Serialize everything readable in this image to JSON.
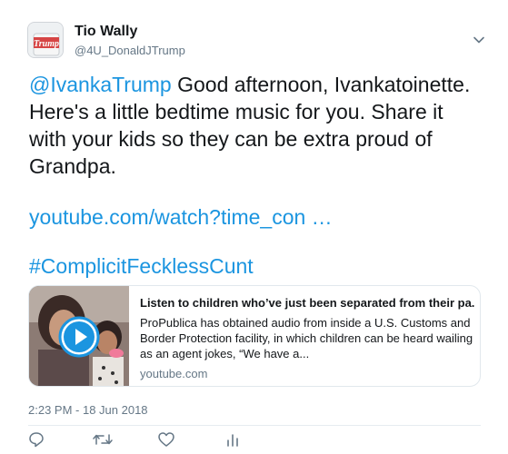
{
  "user": {
    "display_name": "Tio Wally",
    "handle": "@4U_DonaldJTrump",
    "avatar_text": "Trump"
  },
  "tweet": {
    "mention": "@IvankaTrump",
    "text": " Good afternoon, Ivankatoinette. Here's a little bedtime music for you. Share it with your kids so they can be extra proud of Grandpa.",
    "link": "youtube.com/watch?time_con …",
    "hashtag": "#ComplicitFecklessCunt",
    "timestamp": "2:23 PM - 18 Jun 2018"
  },
  "card": {
    "title": "Listen to children who’ve just been separated from their pa...",
    "description": "ProPublica has obtained audio from inside a U.S. Customs and Border Protection facility, in which children can be heard wailing as an agent jokes, “We have a...",
    "domain": "youtube.com"
  },
  "icons": {
    "menu": "chevron-down-icon",
    "reply": "reply-icon",
    "retweet": "retweet-icon",
    "like": "heart-icon",
    "analytics": "analytics-icon"
  },
  "colors": {
    "link": "#1b95e0",
    "secondary": "#657786",
    "border": "#e1e8ed",
    "text": "#14171a"
  }
}
